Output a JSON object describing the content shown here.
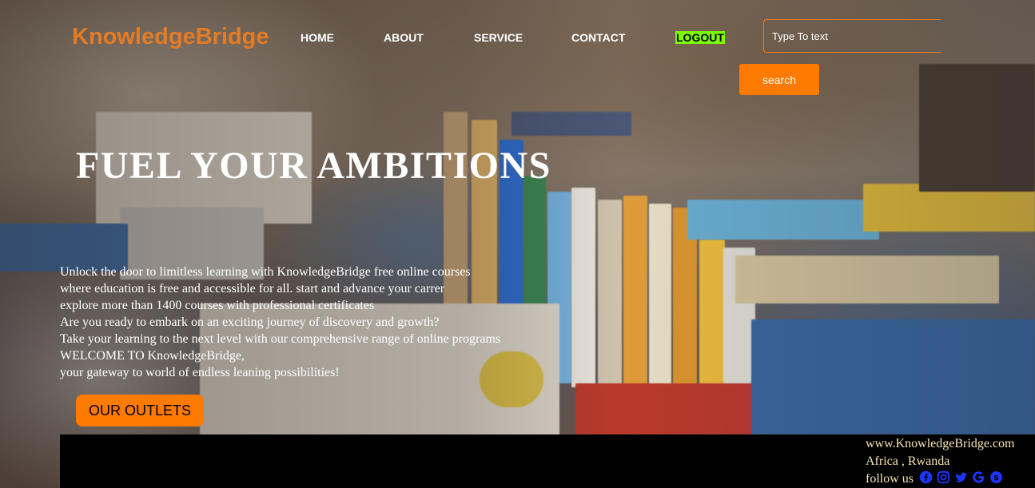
{
  "header": {
    "logo": "KnowledgeBridge",
    "nav": [
      {
        "label": "HOME"
      },
      {
        "label": "ABOUT"
      },
      {
        "label": "SERVICE"
      },
      {
        "label": "CONTACT"
      },
      {
        "label": "LOGOUT"
      }
    ],
    "search": {
      "placeholder": "Type To text",
      "value": "",
      "button_label": "search"
    }
  },
  "hero": {
    "title": "FUEL YOUR AMBITIONS",
    "lines": [
      "Unlock the door to limitless learning with KnowledgeBridge free online courses",
      "where education is free and accessible for all. start and advance your carrer",
      "explore more than 1400 courses with professional certificates",
      "Are you ready to embark on an exciting journey of discovery and growth?",
      "Take your learning to the next level with our comprehensive range of online programs",
      "WELCOME TO KnowledgeBridge,",
      "your gateway to world of endless leaning possibilities!"
    ],
    "cta_label": "OUR OUTLETS"
  },
  "footer": {
    "website": "www.KnowledgeBridge.com",
    "location": "Africa , Rwanda",
    "follow_label": "follow us",
    "social_icons": [
      "facebook-icon",
      "instagram-icon",
      "twitter-icon",
      "google-icon",
      "skype-icon"
    ]
  },
  "colors": {
    "brand": "#e57b24",
    "button": "#ff7a00",
    "logout_highlight": "#7cfc00",
    "social": "#1a35ff",
    "footer_text": "#f5e3b4"
  }
}
